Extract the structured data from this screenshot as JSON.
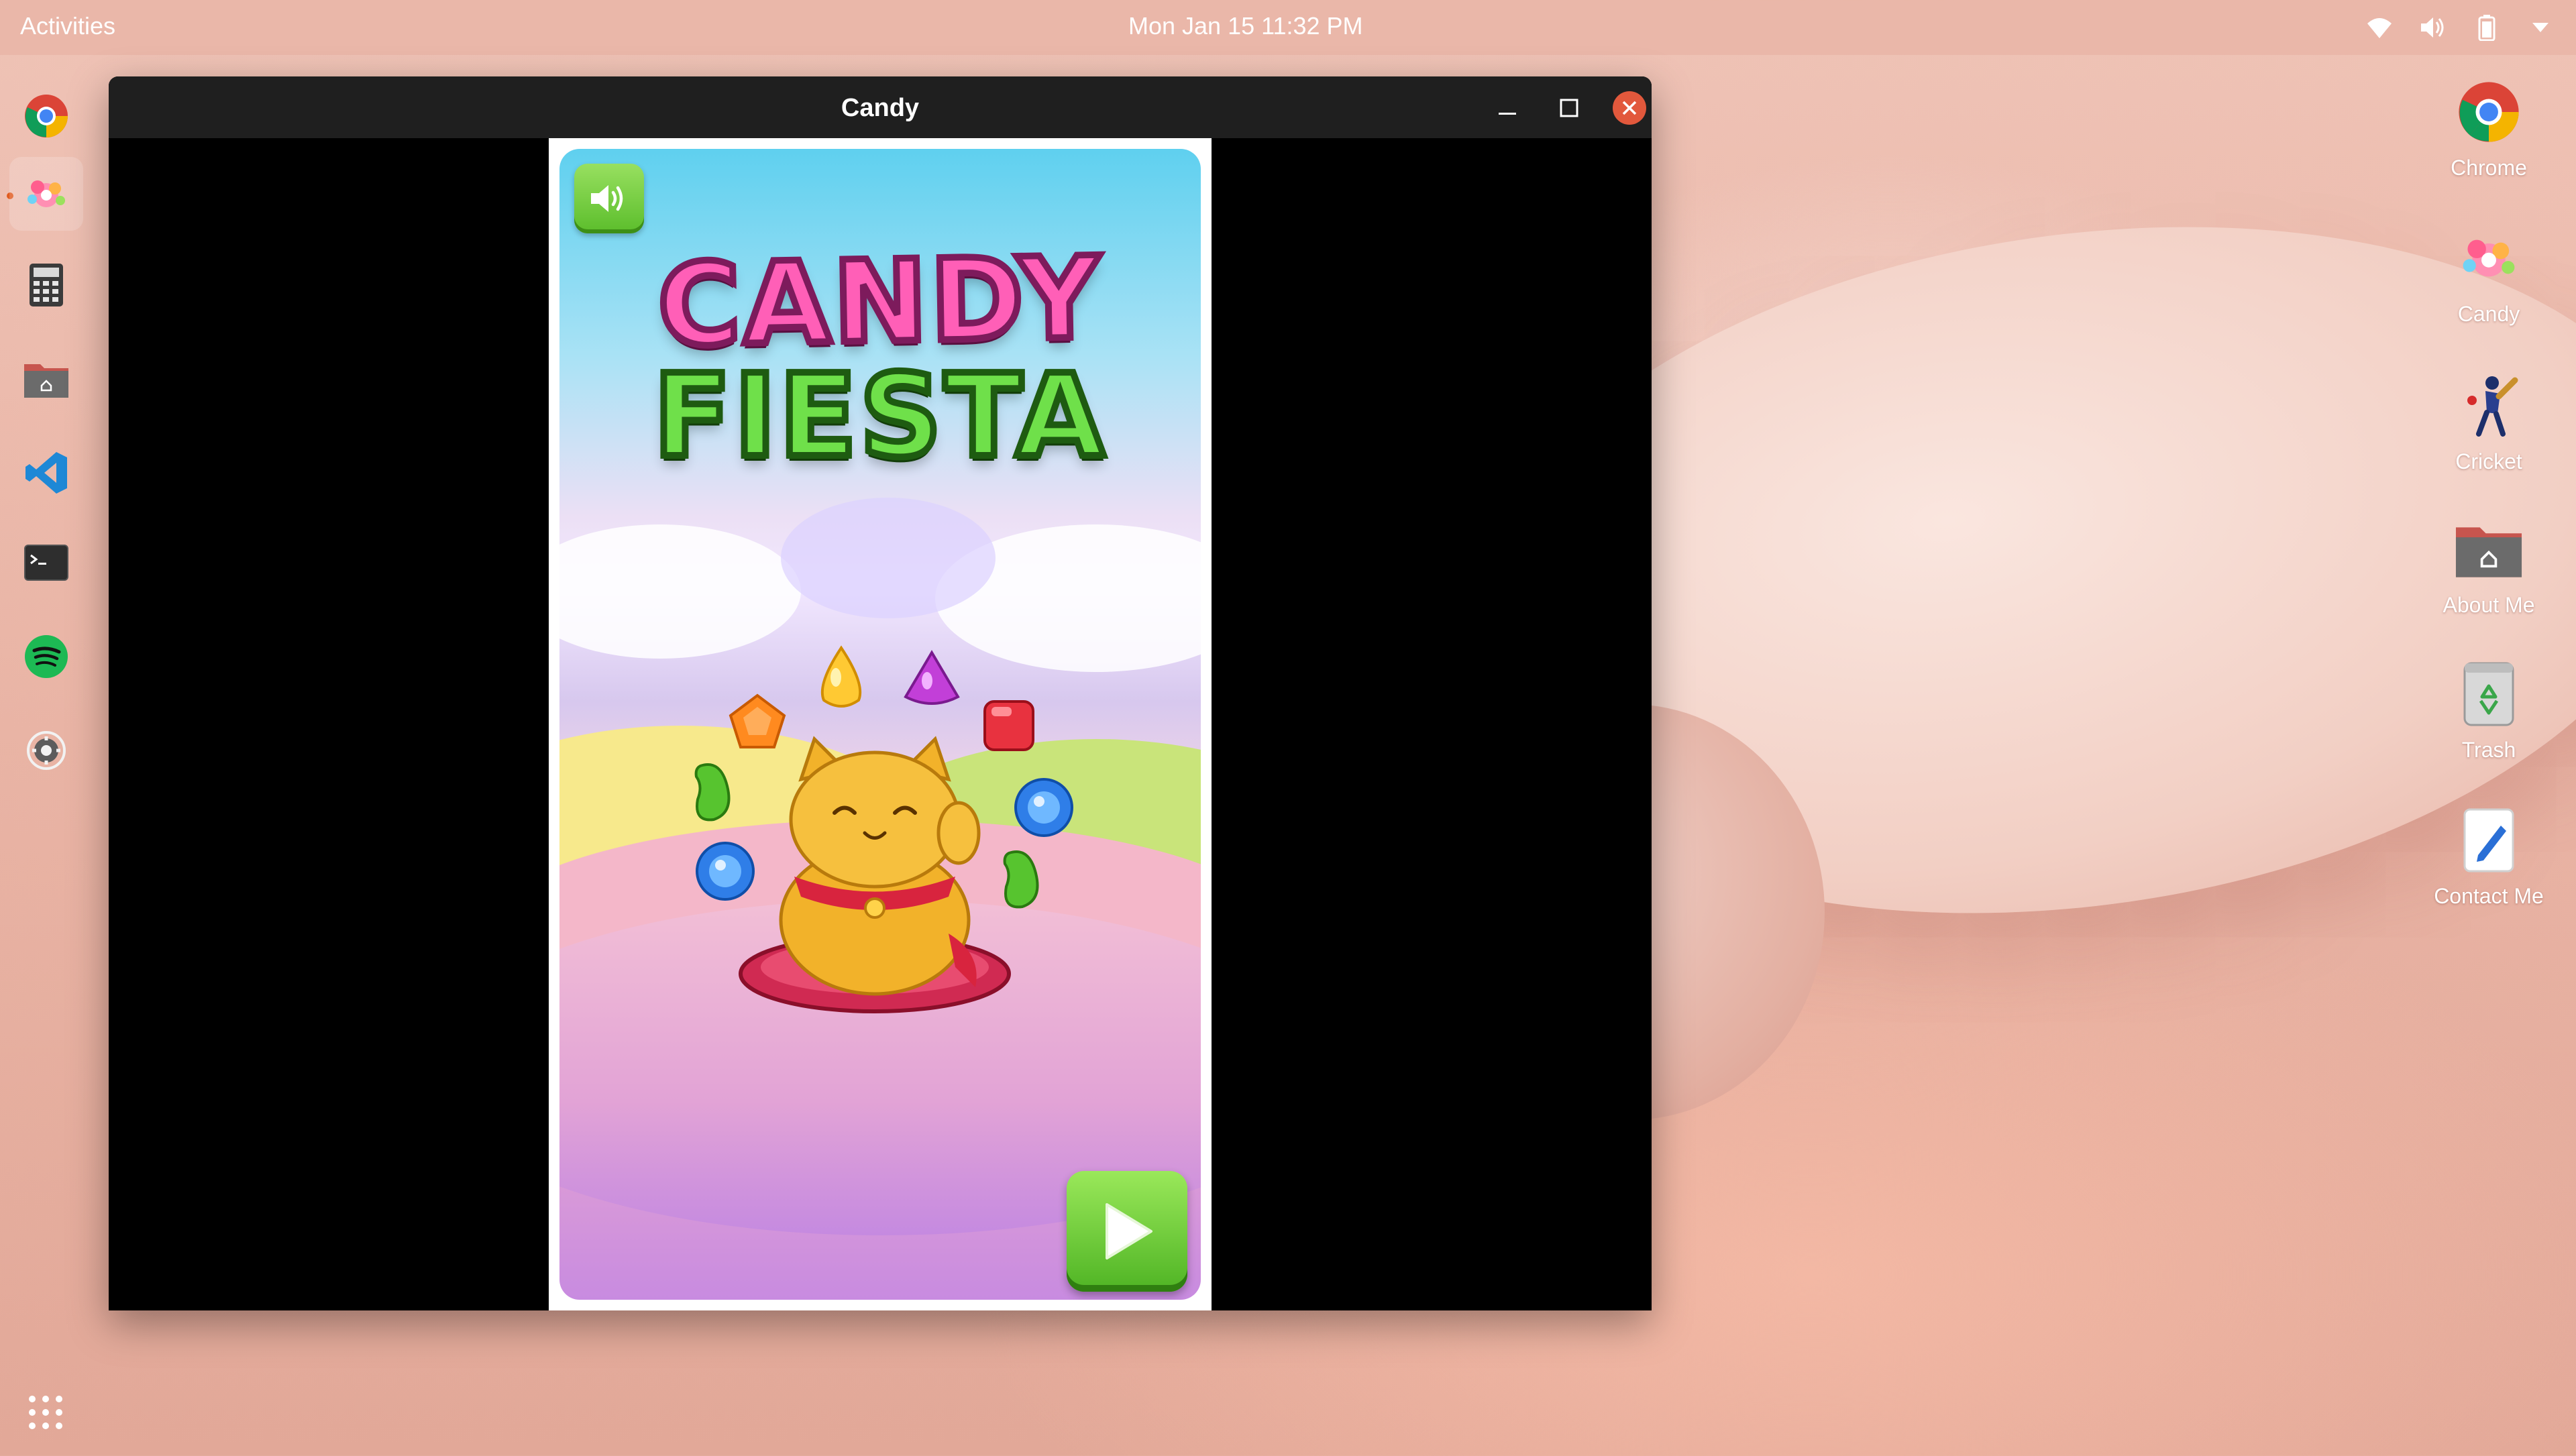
{
  "topbar": {
    "activities": "Activities",
    "clock": "Mon Jan 15 11:32 PM",
    "tray_icons": [
      "wifi-icon",
      "volume-icon",
      "battery-icon",
      "chevron-down-icon"
    ]
  },
  "dock": {
    "items": [
      {
        "name": "chrome",
        "icon": "chrome-icon"
      },
      {
        "name": "candy",
        "icon": "candy-icon",
        "active": true
      },
      {
        "name": "calculator",
        "icon": "calculator-icon"
      },
      {
        "name": "files",
        "icon": "home-folder-icon"
      },
      {
        "name": "vscode",
        "icon": "vscode-icon"
      },
      {
        "name": "terminal",
        "icon": "terminal-icon"
      },
      {
        "name": "spotify",
        "icon": "spotify-icon"
      },
      {
        "name": "settings",
        "icon": "gear-icon"
      }
    ],
    "apps_grid_icon": "apps-grid-icon"
  },
  "window": {
    "title": "Candy",
    "controls": [
      "minimize-icon",
      "maximize-icon",
      "close-icon"
    ]
  },
  "game": {
    "logo_line1": "CANDY",
    "logo_line2": "FIESTA",
    "sound_icon": "speaker-icon",
    "play_icon": "play-icon",
    "colors": {
      "green_button": "#5bbd2b",
      "logo_pink": "#ff5fb7",
      "logo_green": "#6fe04a"
    }
  },
  "desktop_icons": [
    {
      "label": "Chrome",
      "icon": "chrome-icon"
    },
    {
      "label": "Candy",
      "icon": "candy-icon"
    },
    {
      "label": "Cricket",
      "icon": "cricket-icon"
    },
    {
      "label": "About Me",
      "icon": "home-folder-icon"
    },
    {
      "label": "Trash",
      "icon": "trash-icon"
    },
    {
      "label": "Contact Me",
      "icon": "text-editor-icon"
    }
  ]
}
